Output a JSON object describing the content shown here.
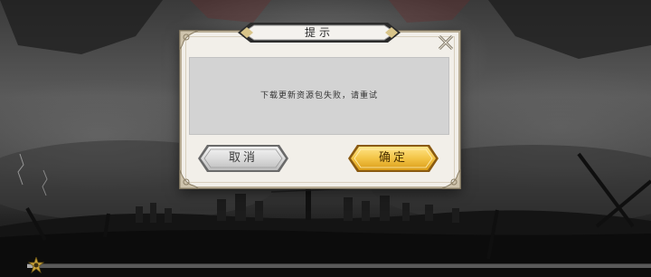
{
  "dialog": {
    "title": "提示",
    "message": "下载更新资源包失败，请重试",
    "cancel_label": "取消",
    "confirm_label": "确定",
    "close_icon": "close-x-icon"
  },
  "loading": {
    "progress": 0.02,
    "icon": "gear-emblem-icon"
  },
  "colors": {
    "dialog_bg": "#f2efe9",
    "content_bg": "#d3d3d3",
    "confirm_gold": "#f3c446",
    "cancel_silver": "#dcdcdc"
  }
}
